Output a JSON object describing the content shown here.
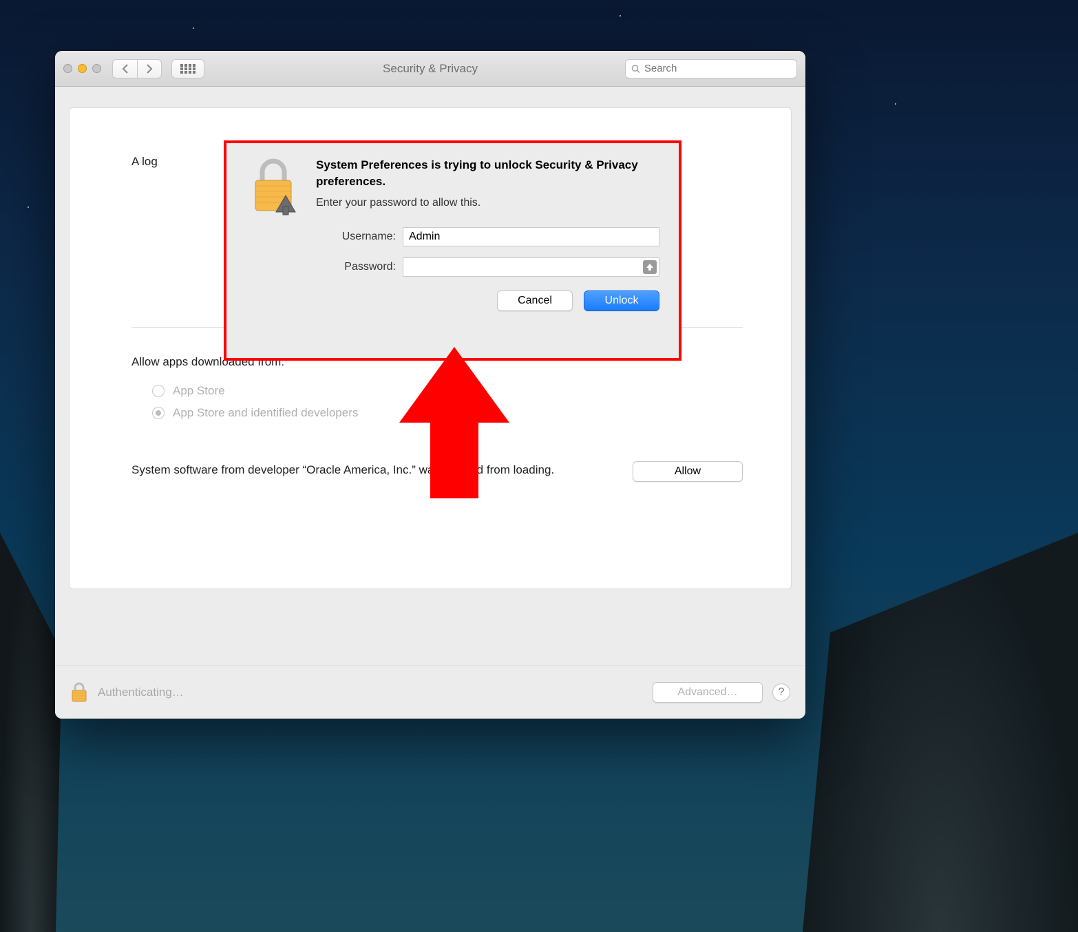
{
  "window": {
    "title": "Security & Privacy",
    "search_placeholder": "Search"
  },
  "panel": {
    "login_partial": "A log",
    "allow_apps_label": "Allow apps downloaded from:",
    "radio_app_store": "App Store",
    "radio_identified": "App Store and identified developers",
    "blocked_message": "System software from developer “Oracle America, Inc.” was blocked from loading.",
    "allow_button": "Allow"
  },
  "footer": {
    "auth_status": "Authenticating…",
    "advanced_button": "Advanced…",
    "help": "?"
  },
  "dialog": {
    "title": "System Preferences is trying to unlock Security & Privacy preferences.",
    "subtitle": "Enter your password to allow this.",
    "username_label": "Username:",
    "username_value": "Admin",
    "password_label": "Password:",
    "password_value": "",
    "cancel": "Cancel",
    "unlock": "Unlock"
  }
}
